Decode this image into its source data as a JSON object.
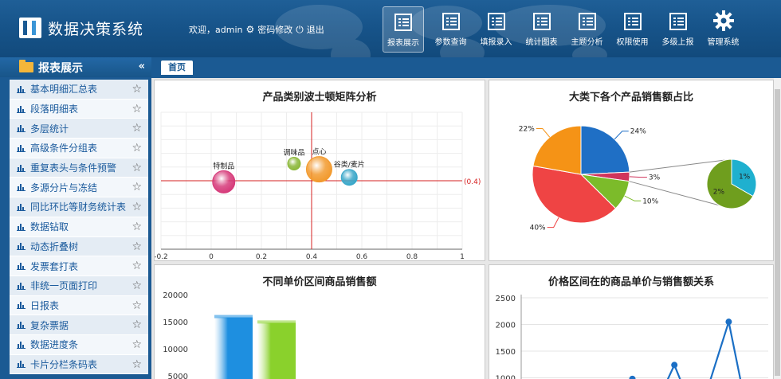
{
  "header": {
    "app_title": "数据决策系统",
    "welcome": "欢迎，admin",
    "change_password": "密码修改",
    "logout": "退出",
    "nav": [
      {
        "label": "报表展示",
        "active": true
      },
      {
        "label": "参数查询"
      },
      {
        "label": "填报录入"
      },
      {
        "label": "统计图表"
      },
      {
        "label": "主题分析"
      },
      {
        "label": "权限使用"
      },
      {
        "label": "多级上报"
      },
      {
        "label": "管理系统"
      }
    ]
  },
  "sidebar": {
    "title": "报表展示",
    "collapse": "«",
    "items": [
      "基本明细汇总表",
      "段落明细表",
      "多层统计",
      "高级条件分组表",
      "重复表头与条件预警",
      "多源分片与冻结",
      "同比环比等财务统计表",
      "数据钻取",
      "动态折叠树",
      "发票套打表",
      "非统一页面打印",
      "日报表",
      "复杂票据",
      "数据进度条",
      "卡片分栏条码表"
    ]
  },
  "tabs": {
    "home": "首页"
  },
  "panels": {
    "bubble_title": "产品类别波士顿矩阵分析",
    "pie_title": "大类下各个产品销售额占比",
    "bar_title": "不同单价区间商品销售额",
    "line_title": "价格区间在的商品单价与销售额关系"
  },
  "chart_data": [
    {
      "type": "scatter",
      "title": "产品类别波士顿矩阵分析",
      "x_ticks": [
        "-0.2",
        "0",
        "0.2",
        "0.4",
        "0.6",
        "0.8",
        "1"
      ],
      "xlim": [
        -0.2,
        1
      ],
      "ylim": [
        -0.2,
        1
      ],
      "reference_label": "(0.4)",
      "reference_line": {
        "x": 0.4,
        "y": 0.4
      },
      "points": [
        {
          "label": "特制品",
          "x": 0.05,
          "y": 0.39,
          "size": 14,
          "color": "#d63b7a"
        },
        {
          "label": "调味品",
          "x": 0.33,
          "y": 0.55,
          "size": 8,
          "color": "#8cb83a"
        },
        {
          "label": "点心",
          "x": 0.43,
          "y": 0.5,
          "size": 16,
          "color": "#f29a2e"
        },
        {
          "label": "谷类/麦片",
          "x": 0.55,
          "y": 0.43,
          "size": 10,
          "color": "#3aa7c9"
        }
      ]
    },
    {
      "type": "pie",
      "title": "大类下各个产品销售额占比",
      "slices": [
        {
          "label": "24%",
          "value": 24,
          "color": "#1f6fc5"
        },
        {
          "label": "3%",
          "value": 3,
          "color": "#d0345c"
        },
        {
          "label": "10%",
          "value": 10,
          "color": "#7cbb2a"
        },
        {
          "label": "40%",
          "value": 40,
          "color": "#ef4444"
        },
        {
          "label": "22%",
          "value": 22,
          "color": "#f59316"
        }
      ],
      "sub_pie": [
        {
          "label": "1%",
          "value": 1,
          "color": "#1fb0cf"
        },
        {
          "label": "2%",
          "value": 2,
          "color": "#6f9e1e"
        }
      ]
    },
    {
      "type": "bar",
      "title": "不同单价区间商品销售额",
      "y_ticks": [
        "20000",
        "15000",
        "10000",
        "5000"
      ],
      "ylim": [
        0,
        20000
      ],
      "values": [
        15800,
        14800
      ],
      "colors": [
        "#1e8fe0",
        "#8ad12c"
      ]
    },
    {
      "type": "line",
      "title": "价格区间在的商品单价与销售额关系",
      "y_ticks": [
        "2500",
        "2000",
        "1500",
        "1000"
      ],
      "ylim": [
        500,
        2500
      ],
      "points": [
        {
          "x": 0.45,
          "y": 980
        },
        {
          "x": 0.62,
          "y": 1240
        },
        {
          "x": 0.84,
          "y": 2050
        }
      ],
      "color": "#1b6fc5"
    }
  ]
}
